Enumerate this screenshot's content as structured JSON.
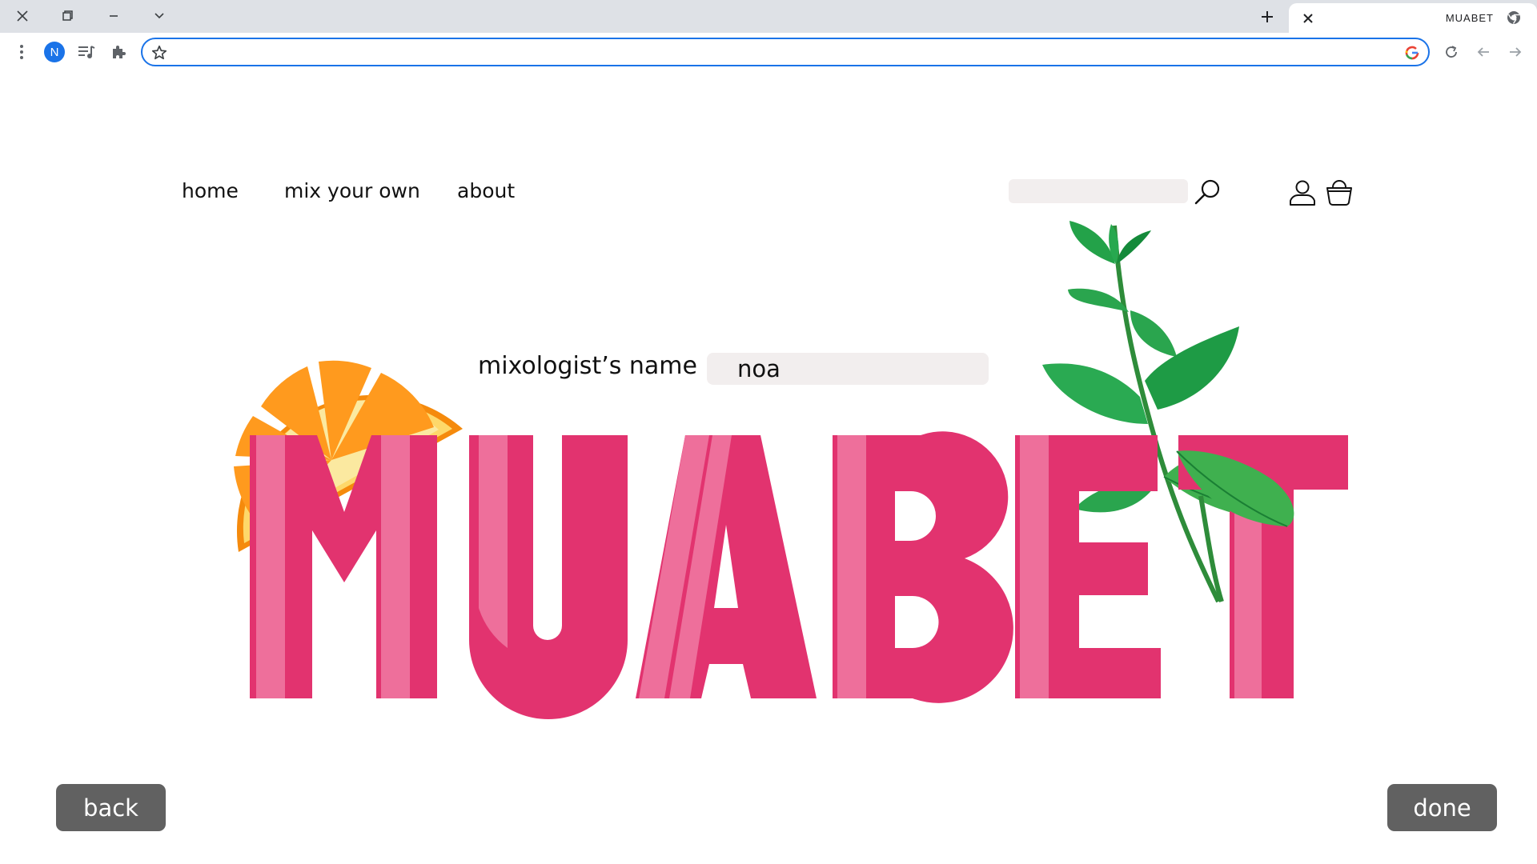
{
  "browser": {
    "tab_title": "MUABET",
    "address_value": "",
    "profile_initial": "N",
    "accent": "#1a73e8"
  },
  "nav": {
    "items": [
      {
        "label": "home"
      },
      {
        "label": "mix your own"
      },
      {
        "label": "about"
      }
    ],
    "search_placeholder": ""
  },
  "form": {
    "name_label": "mixologist’s name",
    "name_value": "noa"
  },
  "logo": {
    "text": "MUABET",
    "main_color": "#e2336f",
    "stripe_color": "#ee6f9b",
    "decorations": [
      "orange-slice",
      "mint-sprig"
    ]
  },
  "actions": {
    "back_label": "back",
    "done_label": "done",
    "button_color": "#616161"
  }
}
